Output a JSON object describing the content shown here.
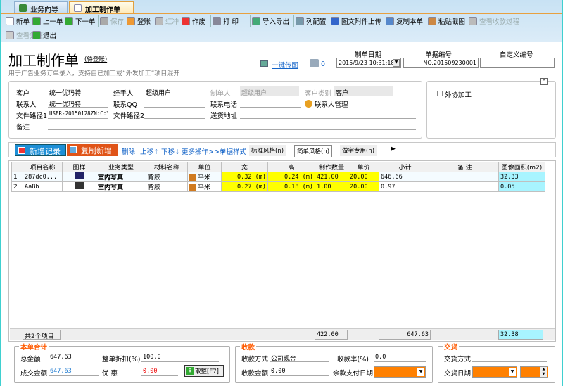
{
  "tabs": [
    {
      "label": "业务向导",
      "active": false
    },
    {
      "label": "加工制作单",
      "active": true
    }
  ],
  "toolbar": {
    "row1": [
      {
        "label": "新单",
        "icon": "new-doc-icon",
        "enabled": true
      },
      {
        "label": "上一单",
        "icon": "arrow-left-icon",
        "enabled": true
      },
      {
        "label": "下一单",
        "icon": "arrow-right-icon",
        "enabled": true
      },
      {
        "label": "保存",
        "icon": "save-icon",
        "enabled": false
      },
      {
        "label": "登账",
        "icon": "post-icon",
        "enabled": true
      },
      {
        "label": "红冲",
        "icon": "reverse-icon",
        "enabled": false
      },
      {
        "label": "作废",
        "icon": "void-icon",
        "enabled": true
      },
      {
        "label": "打 印",
        "icon": "print-icon",
        "enabled": true
      },
      {
        "label": "导入导出",
        "icon": "import-export-icon",
        "enabled": true
      },
      {
        "label": "列配置",
        "icon": "columns-icon",
        "enabled": true
      },
      {
        "label": "图文附件上传",
        "icon": "paperclip-icon",
        "enabled": true
      },
      {
        "label": "复制本单",
        "icon": "copy-icon",
        "enabled": true
      },
      {
        "label": "粘贴截图",
        "icon": "paste-icon",
        "enabled": true
      },
      {
        "label": "查看收款过程",
        "icon": "view-payment-icon",
        "enabled": false
      }
    ],
    "row2": [
      {
        "label": "查看凭证",
        "icon": "voucher-icon",
        "enabled": false
      },
      {
        "label": "退出",
        "icon": "exit-icon",
        "enabled": true
      }
    ]
  },
  "header": {
    "title": "加工制作单",
    "status": "(待登账)",
    "subtitle": "用于广告业务订单录入，支持自已加工或“外发加工”项目混开",
    "upload_link": "一键传图",
    "print_count": "0",
    "date_label": "制单日期",
    "date_value": "2015/9/23 10:31:18",
    "number_label": "单据编号",
    "number_value": "NO.201509230001",
    "custom_label": "自定义编号",
    "custom_value": ""
  },
  "form": {
    "customer_label": "客户",
    "customer": "统一优玛特",
    "handler_label": "经手人",
    "handler": "超级用户",
    "creator_label": "制单人",
    "creator": "超级用户",
    "ctype_label": "客户类别",
    "ctype": "客户",
    "contact_label": "联系人",
    "contact": "统一优玛特",
    "qq_label": "联系QQ",
    "qq": "",
    "phone_label": "联系电话",
    "phone": "",
    "contact_mgr": "联系人管理",
    "path1_label": "文件路径1",
    "path1": "USER-20150128ZN:C:\\",
    "path2_label": "文件路径2",
    "path2": "",
    "addr_label": "送货地址",
    "addr": "",
    "note_label": "备注",
    "note": "",
    "outsource": "外协加工"
  },
  "actions": {
    "add": "新增记录",
    "copy_add": "复制新增",
    "delete": "删除",
    "up": "上移↑",
    "down": "下移↓",
    "more": "更多操作>>>",
    "style": "单据样式",
    "styles": [
      "标准风格(n)",
      "简单风格(n)",
      "做字专用(n)"
    ]
  },
  "table": {
    "columns": [
      "",
      "项目名称",
      "图样",
      "业务类型",
      "材料名称",
      "单位",
      "宽",
      "高",
      "制作数量",
      "单价",
      "小计",
      "备 注",
      "图像面积(m2)"
    ],
    "rows": [
      {
        "n": "1",
        "name": "287dc0...",
        "type": "室内写真",
        "material": "背胶",
        "unit": "平米",
        "w": "0.32 (m)",
        "h": "0.24 (m)",
        "qty": "421.00",
        "price": "20.00",
        "subtotal": "646.66",
        "note": "",
        "area": "32.33"
      },
      {
        "n": "2",
        "name": "AaBb",
        "type": "室内写真",
        "material": "背胶",
        "unit": "平米",
        "w": "0.27 (m)",
        "h": "0.18 (m)",
        "qty": "1.00",
        "price": "20.00",
        "subtotal": "0.97",
        "note": "",
        "area": "0.05"
      }
    ],
    "footer": {
      "count": "共2个项目",
      "qty": "422.00",
      "subtotal": "647.63",
      "area": "32.38"
    }
  },
  "summary": {
    "title": "本单合计",
    "total_label": "总金额",
    "total": "647.63",
    "discount_label": "整单折扣(%)",
    "discount": "100.0",
    "deal_label": "成交金额",
    "deal": "647.63",
    "offer_label": "优 惠",
    "offer": "0.00",
    "round_btn": "取整[F7]"
  },
  "payment": {
    "title": "收款",
    "method_label": "收款方式",
    "method": "公司现金",
    "rate_label": "收款率(%)",
    "rate": "0.0",
    "amount_label": "收款金额",
    "amount": "0.00",
    "due_label": "余款支付日期"
  },
  "delivery": {
    "title": "交货",
    "method_label": "交货方式",
    "method": "",
    "date_label": "交货日期"
  },
  "colors": {
    "add_button": "#1e8fd6",
    "copy_button": "#e05418",
    "highlight_yellow": "#ffff00",
    "area_cyan": "#a8f4ff",
    "group_title": "#ff5a00"
  }
}
